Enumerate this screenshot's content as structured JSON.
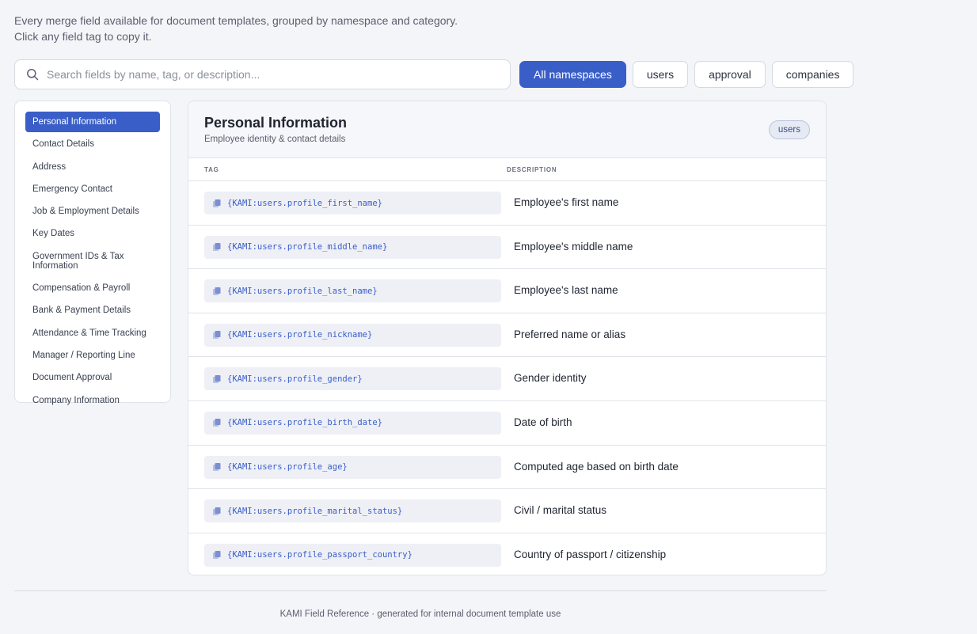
{
  "intro": "Every merge field available for document templates, grouped by namespace and category. Click any field tag to copy it.",
  "search": {
    "placeholder": "Search fields by name, tag, or description..."
  },
  "namespaces": [
    "All namespaces",
    "users",
    "approval",
    "companies"
  ],
  "active_namespace": "All namespaces",
  "categories": [
    "Personal Information",
    "Contact Details",
    "Address",
    "Emergency Contact",
    "Job & Employment Details",
    "Key Dates",
    "Government IDs & Tax Information",
    "Compensation & Payroll",
    "Bank & Payment Details",
    "Attendance & Time Tracking",
    "Manager / Reporting Line",
    "Document Approval",
    "Company Information"
  ],
  "active_category": "Personal Information",
  "panel": {
    "title": "Personal Information",
    "subtitle": "Employee identity & contact details",
    "namespace_badge": "users",
    "col_tag": "TAG",
    "col_description": "DESCRIPTION",
    "fields": [
      {
        "tag": "{KAMI:users.profile_first_name}",
        "description": "Employee's first name"
      },
      {
        "tag": "{KAMI:users.profile_middle_name}",
        "description": "Employee's middle name"
      },
      {
        "tag": "{KAMI:users.profile_last_name}",
        "description": "Employee's last name"
      },
      {
        "tag": "{KAMI:users.profile_nickname}",
        "description": "Preferred name or alias"
      },
      {
        "tag": "{KAMI:users.profile_gender}",
        "description": "Gender identity"
      },
      {
        "tag": "{KAMI:users.profile_birth_date}",
        "description": "Date of birth"
      },
      {
        "tag": "{KAMI:users.profile_age}",
        "description": "Computed age based on birth date"
      },
      {
        "tag": "{KAMI:users.profile_marital_status}",
        "description": "Civil / marital status"
      },
      {
        "tag": "{KAMI:users.profile_passport_country}",
        "description": "Country of passport / citizenship"
      }
    ]
  },
  "footer": "KAMI Field Reference · generated for internal document template use",
  "colors": {
    "accent": "#3a5ec7",
    "tag_text": "#3a5ec7",
    "background": "#f4f5f8"
  },
  "icons": {
    "search": "search-icon",
    "copy": "copy-icon"
  }
}
